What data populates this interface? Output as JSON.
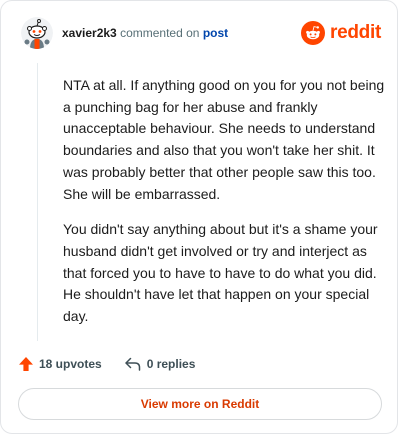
{
  "comment": {
    "username": "xavier2k3",
    "action_text": "commented on",
    "post_link_label": "post",
    "paragraphs": [
      "NTA at all. If anything good on you for you not being a punching bag for her abuse and frankly unacceptable behaviour. She needs to understand boundaries and also that you won't take her shit. It was probably better that other people saw this too. She will be embarrassed.",
      "You didn't say anything about but it's a shame your husband didn't get involved or try and interject as that forced you to have to have to do what you did. He shouldn't have let that happen on your special day."
    ],
    "upvotes_label": "18 upvotes",
    "replies_label": "0 replies"
  },
  "brand": {
    "wordmark": "reddit",
    "icon": "reddit-alien-icon",
    "color": "#ff4500"
  },
  "footer": {
    "view_more_label": "View more on Reddit"
  },
  "icons": {
    "upvote": "upvote-arrow-icon",
    "reply": "reply-arrow-icon",
    "avatar": "snoo-avatar"
  },
  "colors": {
    "upvote": "#ff4500",
    "link": "#0045ac",
    "button_text": "#d93a00"
  }
}
